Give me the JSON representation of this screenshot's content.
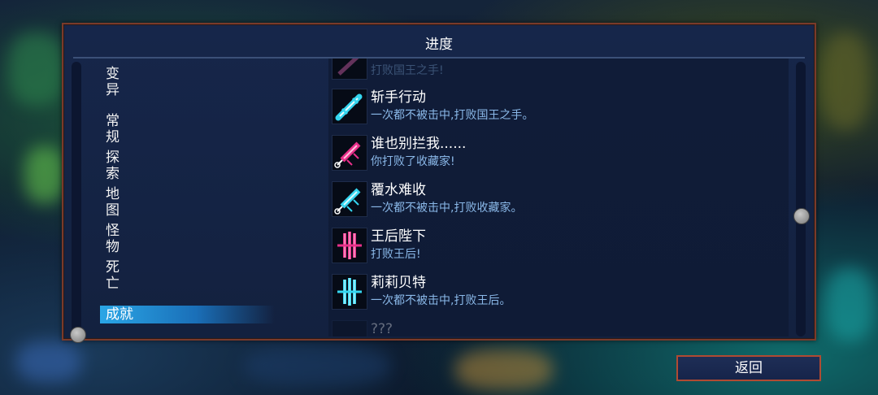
{
  "dialog": {
    "title": "进度"
  },
  "categories": [
    {
      "label": "变异"
    },
    {
      "label": "常规"
    },
    {
      "label": "探索"
    },
    {
      "label": "地图"
    },
    {
      "label": "怪物"
    },
    {
      "label": "死亡"
    },
    {
      "label": "成就",
      "active": true
    }
  ],
  "achievements": {
    "partial_top": {
      "desc": "打败国王之手!"
    },
    "items": [
      {
        "name": "斩手行动",
        "desc": "一次都不被击中,打败国王之手。",
        "icon": "cyan-sword-icon",
        "color": "#35d6f0"
      },
      {
        "name": "谁也别拦我......",
        "desc": "你打败了收藏家!",
        "icon": "magenta-syringe-icon",
        "color": "#e8308a"
      },
      {
        "name": "覆水难收",
        "desc": "一次都不被击中,打败收藏家。",
        "icon": "cyan-syringe-icon",
        "color": "#35d6f0"
      },
      {
        "name": "王后陛下",
        "desc": "打败王后!",
        "icon": "magenta-claw-icon",
        "color": "#e8308a"
      },
      {
        "name": "莉莉贝特",
        "desc": "一次都不被击中,打败王后。",
        "icon": "cyan-claw-icon",
        "color": "#35d6f0"
      }
    ],
    "partial_bottom": {
      "name": "???"
    }
  },
  "footer": {
    "back_label": "返回"
  },
  "colors": {
    "accent": "#2aa6e6",
    "frame": "#7a3a2a",
    "desc": "#8ab8e8"
  }
}
